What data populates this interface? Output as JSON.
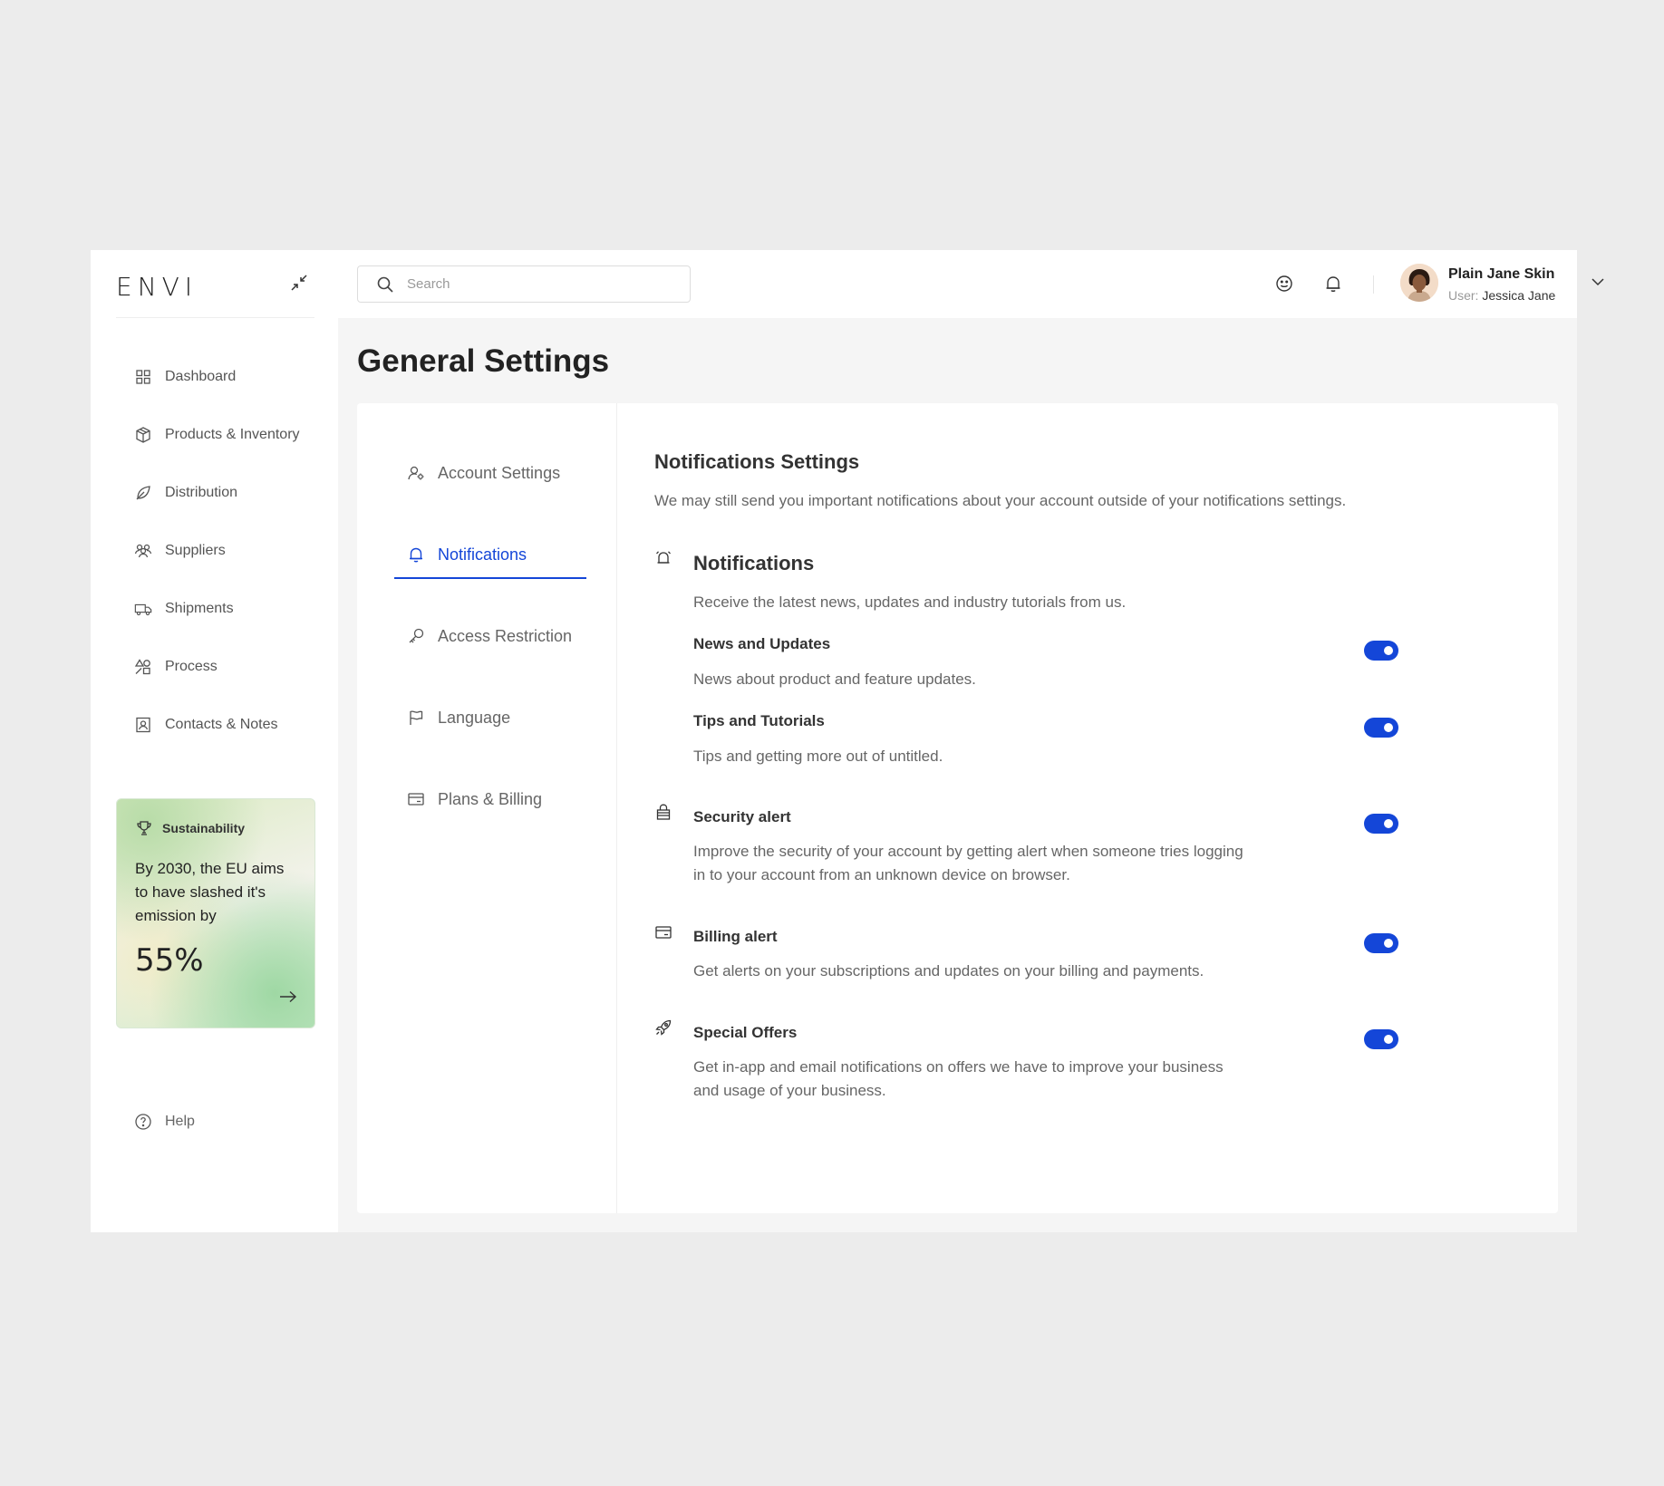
{
  "app": {
    "logo": "ENVI"
  },
  "sidebar": {
    "items": [
      {
        "label": "Dashboard",
        "icon": "grid-icon"
      },
      {
        "label": "Products & Inventory",
        "icon": "box-icon"
      },
      {
        "label": "Distribution",
        "icon": "leaf-icon"
      },
      {
        "label": "Suppliers",
        "icon": "users-icon"
      },
      {
        "label": "Shipments",
        "icon": "truck-icon"
      },
      {
        "label": "Process",
        "icon": "shapes-icon"
      },
      {
        "label": "Contacts & Notes",
        "icon": "contact-icon"
      }
    ],
    "promo": {
      "heading": "Sustainability",
      "text": "By 2030, the EU aims to have slashed it's emission by",
      "value": "55%"
    },
    "help_label": "Help"
  },
  "topbar": {
    "search_placeholder": "Search",
    "user": {
      "name": "Plain Jane Skin",
      "sub_prefix": "User:",
      "sub_name": "Jessica Jane"
    }
  },
  "page": {
    "title": "General Settings"
  },
  "subnav": {
    "items": [
      {
        "label": "Account Settings",
        "icon": "user-gear-icon"
      },
      {
        "label": "Notifications",
        "icon": "bell-icon",
        "active": true
      },
      {
        "label": "Access Restriction",
        "icon": "key-icon"
      },
      {
        "label": "Language",
        "icon": "flag-icon"
      },
      {
        "label": "Plans & Billing",
        "icon": "card-icon"
      }
    ]
  },
  "content": {
    "title": "Notifications Settings",
    "description": "We may still send you important notifications about your account outside of your notifications settings.",
    "notifications": {
      "title": "Notifications",
      "description": "Receive the latest news, updates and industry tutorials from us.",
      "news": {
        "title": "News and Updates",
        "description": "News about product and feature updates.",
        "enabled": true
      },
      "tips": {
        "title": "Tips and Tutorials",
        "description": "Tips and getting more out of untitled.",
        "enabled": true
      }
    },
    "security": {
      "title": "Security alert",
      "description": "Improve the security of your account by getting alert when someone tries logging in to your account from an unknown device on browser.",
      "enabled": true
    },
    "billing": {
      "title": "Billing alert",
      "description": "Get alerts on your subscriptions and updates on your billing and payments.",
      "enabled": true
    },
    "offers": {
      "title": "Special Offers",
      "description": "Get in-app and email notifications on offers we have to improve your business and usage of your business.",
      "enabled": true
    }
  },
  "colors": {
    "accent": "#1446d8",
    "background": "#ececec",
    "panel": "#f5f5f5"
  }
}
